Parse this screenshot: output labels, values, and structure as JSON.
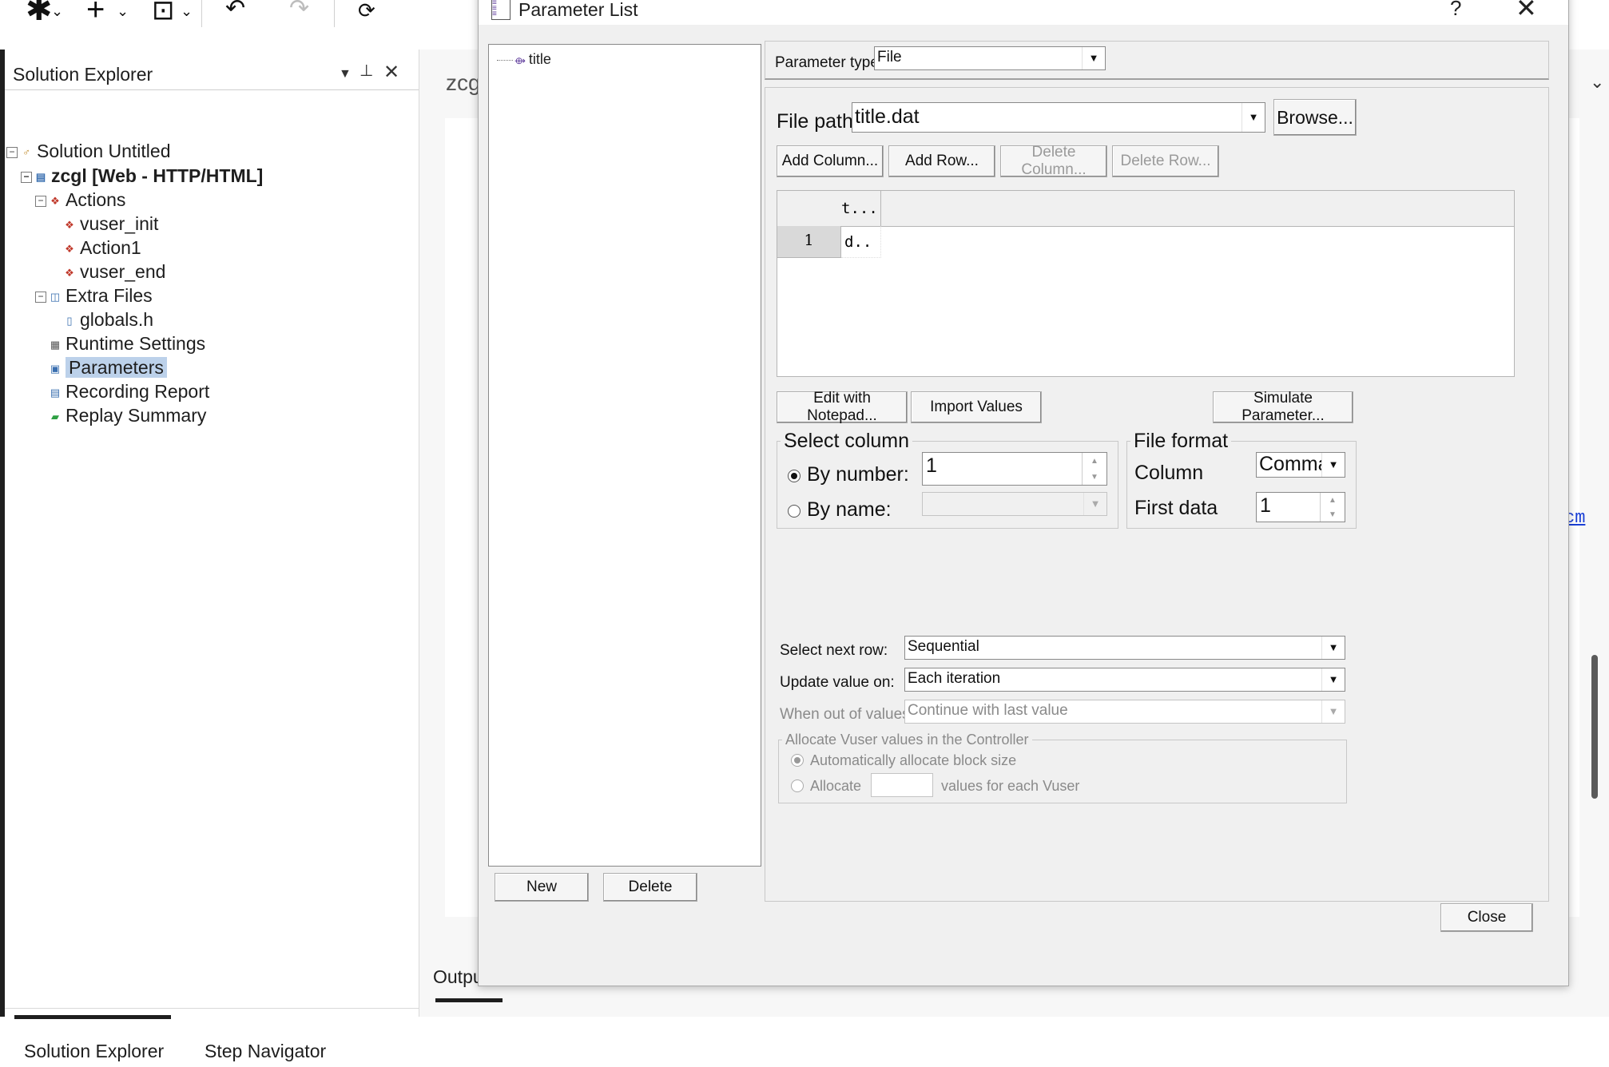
{
  "toolbar": {
    "icons": [
      "asterisk-menu-icon",
      "add-icon",
      "save-icon",
      "undo-icon",
      "redo-icon"
    ]
  },
  "solution_explorer": {
    "title": "Solution Explorer",
    "tree": {
      "solution": "Solution Untitled",
      "script": "zcgl [Web - HTTP/HTML]",
      "actions": "Actions",
      "action_items": [
        "vuser_init",
        "Action1",
        "vuser_end"
      ],
      "extra_files": "Extra Files",
      "extra_items": [
        "globals.h"
      ],
      "runtime_settings": "Runtime Settings",
      "parameters": "Parameters",
      "recording_report": "Recording Report",
      "replay_summary": "Replay Summary"
    },
    "bottom_tabs": [
      "Solution Explorer",
      "Step Navigator"
    ]
  },
  "editor": {
    "tab_text": "zcg",
    "output_label": "Outpu",
    "right_link_text": "cm"
  },
  "dialog": {
    "title": "Parameter List",
    "help": "?",
    "close_glyph": "✕",
    "parameters": [
      "title"
    ],
    "new_button": "New",
    "delete_button": "Delete",
    "parameter_type": {
      "label": "Parameter type:",
      "value": "File"
    },
    "file_path": {
      "label": "File path:",
      "value": "title.dat",
      "browse": "Browse..."
    },
    "table_buttons": {
      "add_column": "Add Column...",
      "add_row": "Add Row...",
      "delete_column": "Delete Column...",
      "delete_row": "Delete Row..."
    },
    "grid": {
      "column_header": "t...",
      "row_number": "1",
      "cell_value": "d.."
    },
    "edit_notepad": "Edit with Notepad...",
    "import_values": "Import Values",
    "simulate": "Simulate Parameter...",
    "select_column": {
      "legend": "Select column",
      "by_number_label": "By number:",
      "by_number_value": "1",
      "by_name_label": "By name:",
      "selected": "by_number"
    },
    "file_format": {
      "legend": "File format",
      "column_label": "Column",
      "column_value": "Comma",
      "first_data_label": "First data",
      "first_data_value": "1"
    },
    "select_next_row": {
      "label": "Select next row:",
      "value": "Sequential"
    },
    "update_value_on": {
      "label": "Update value on:",
      "value": "Each iteration"
    },
    "when_out_of_values": {
      "label": "When out of values:",
      "value": "Continue with last value"
    },
    "allocate": {
      "legend": "Allocate Vuser values in the Controller",
      "auto_label": "Automatically allocate block size",
      "allocate_label": "Allocate",
      "values_suffix": "values for each Vuser",
      "selected": "auto"
    },
    "close_button": "Close"
  }
}
